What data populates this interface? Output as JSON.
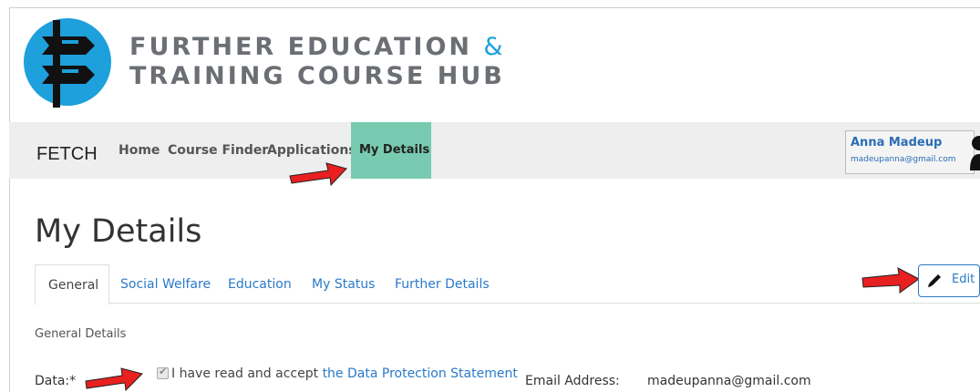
{
  "logo": {
    "line1": "FURTHER EDUCATION",
    "ampersand": "&",
    "line2": "TRAINING COURSE HUB",
    "colors": {
      "circle": "#1ea0dc",
      "text": "#6b6f74"
    }
  },
  "navbar": {
    "brand": "FETCH",
    "items": [
      {
        "label": "Home"
      },
      {
        "label": "Course Finder"
      },
      {
        "label": "Applications"
      },
      {
        "label": "My Details",
        "active": true
      }
    ],
    "active_color": "#78cbb0"
  },
  "user": {
    "name": "Anna Madeup",
    "email": "madeupanna@gmail.com"
  },
  "page": {
    "title": "My Details"
  },
  "tabs": [
    {
      "label": "General",
      "active": true
    },
    {
      "label": "Social Welfare"
    },
    {
      "label": "Education"
    },
    {
      "label": "My Status"
    },
    {
      "label": "Further Details"
    }
  ],
  "edit_button": {
    "label": "Edit",
    "icon": "pencil-icon"
  },
  "general": {
    "section_title": "General Details",
    "data_label": "Data:*",
    "data_checkbox_checked": true,
    "data_text": "I have read and accept ",
    "data_link": "the Data Protection Statement",
    "email_label": "Email Address:",
    "email_value": "madeupanna@gmail.com"
  },
  "annotations": {
    "arrow_color": "#e8201f"
  }
}
